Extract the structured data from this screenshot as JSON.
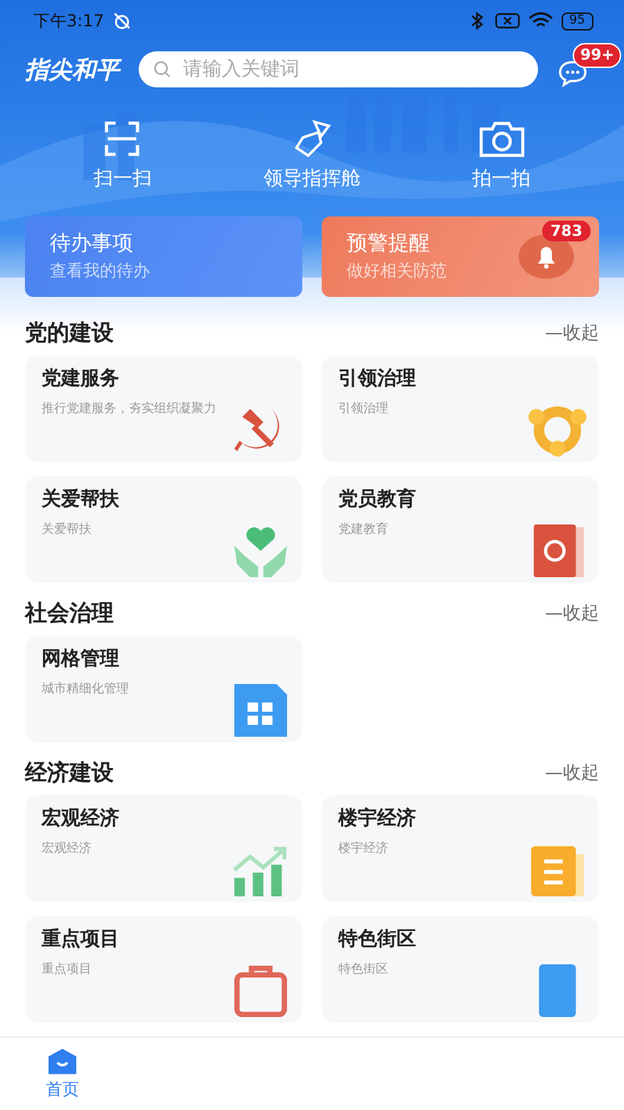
{
  "status_bar": {
    "time": "下午3:17",
    "battery": "95"
  },
  "header": {
    "logo": "指尖和平",
    "search": {
      "placeholder": "请输入关键词"
    },
    "message_badge": "99+"
  },
  "quick_actions": [
    {
      "label": "扫一扫",
      "kind": "scan"
    },
    {
      "label": "领导指挥舱",
      "kind": "flag"
    },
    {
      "label": "拍一拍",
      "kind": "camera"
    }
  ],
  "banners": [
    {
      "title": "待办事项",
      "subtitle": "查看我的待办",
      "kind": "todo"
    },
    {
      "title": "预警提醒",
      "subtitle": "做好相关防范",
      "kind": "alert",
      "badge": "783"
    }
  ],
  "sections": [
    {
      "title": "党的建设",
      "toggle": "—收起",
      "items": [
        {
          "title": "党建服务",
          "subtitle": "推行党建服务，夯实组织凝聚力",
          "kind": "emblem"
        },
        {
          "title": "引领治理",
          "subtitle": "引领治理",
          "kind": "ring"
        },
        {
          "title": "关爱帮扶",
          "subtitle": "关爱帮扶",
          "kind": "heart"
        },
        {
          "title": "党员教育",
          "subtitle": "党建教育",
          "kind": "book"
        }
      ]
    },
    {
      "title": "社会治理",
      "toggle": "—收起",
      "items": [
        {
          "title": "网格管理",
          "subtitle": "城市精细化管理",
          "kind": "grid"
        }
      ]
    },
    {
      "title": "经济建设",
      "toggle": "—收起",
      "items": [
        {
          "title": "宏观经济",
          "subtitle": "宏观经济",
          "kind": "chart"
        },
        {
          "title": "楼宇经济",
          "subtitle": "楼宇经济",
          "kind": "doc"
        },
        {
          "title": "重点项目",
          "subtitle": "重点项目",
          "kind": "box"
        },
        {
          "title": "特色街区",
          "subtitle": "特色街区",
          "kind": "tile"
        }
      ]
    }
  ],
  "tab_bar": [
    {
      "label": "首页",
      "selected": true,
      "kind": "home"
    }
  ]
}
